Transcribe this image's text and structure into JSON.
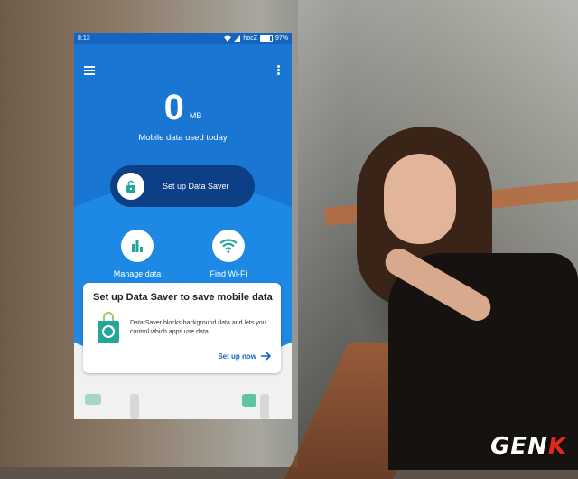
{
  "statusbar": {
    "time": "8:13",
    "carrier": "hocZ",
    "battery": "97%"
  },
  "appbar": {
    "menu_icon": "menu-icon",
    "more_icon": "more-vert-icon"
  },
  "usage": {
    "value": "0",
    "unit": "MB",
    "label": "Mobile data used today"
  },
  "primary_action": {
    "label": "Set up Data Saver",
    "icon": "lock-icon"
  },
  "actions": [
    {
      "label": "Manage data",
      "icon": "bar-chart-icon"
    },
    {
      "label": "Find Wi-Fi",
      "icon": "wifi-icon"
    }
  ],
  "card": {
    "title": "Set up Data Saver to save mobile data",
    "description": "Data Saver blocks background data and lets you control which apps use data.",
    "link_label": "Set up now",
    "icon": "shopping-bag-icon"
  },
  "watermark": {
    "prefix": "GEN",
    "accent": "K"
  },
  "colors": {
    "primary": "#1976d2",
    "dark": "#0d3f86",
    "accent_green": "#26a69a"
  }
}
